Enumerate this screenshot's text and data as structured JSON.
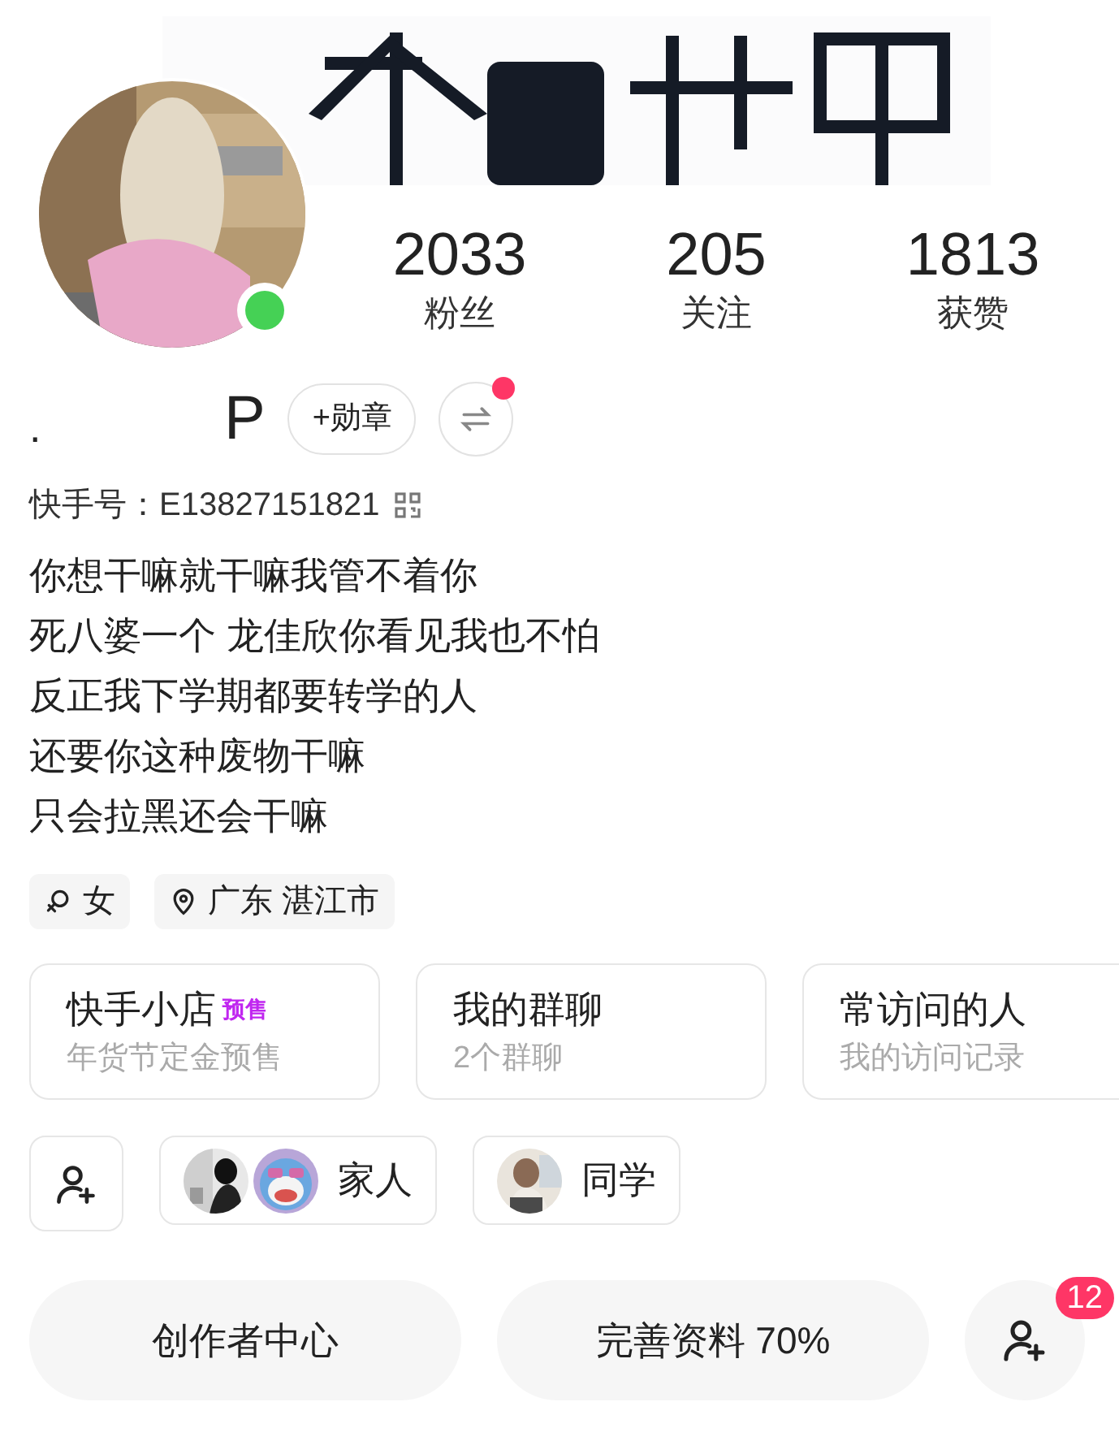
{
  "cover": {
    "kind": "picture"
  },
  "avatar": {
    "kind": "picture",
    "online": true
  },
  "stats": [
    {
      "value": "2033",
      "label": "粉丝"
    },
    {
      "value": "205",
      "label": "关注"
    },
    {
      "value": "1813",
      "label": "获赞"
    }
  ],
  "name_parts": [
    ".",
    "P"
  ],
  "badge_button": "+勋章",
  "switch_button": {
    "has_dot": true
  },
  "account_id": "快手号：E13827151821",
  "bio": [
    "你想干嘛就干嘛我管不着你",
    "死八婆一个 龙佳欣你看见我也不怕",
    "反正我下学期都要转学的人",
    "还要你这种废物干嘛",
    "只会拉黑还会干嘛"
  ],
  "tags": [
    {
      "kind": "gender",
      "text": "女"
    },
    {
      "kind": "location",
      "text": "广东 湛江市"
    }
  ],
  "cards": [
    {
      "title": "快手小店",
      "badge": "预售",
      "subtitle": "年货节定金预售"
    },
    {
      "title": "我的群聊",
      "subtitle": "2个群聊"
    },
    {
      "title": "常访问的人",
      "subtitle": "我的访问记录"
    }
  ],
  "groups": [
    {
      "label": "家人",
      "avatars": [
        {
          "kind": "picture"
        },
        {
          "kind": "picture"
        }
      ]
    },
    {
      "label": "同学",
      "avatars": [
        {
          "kind": "picture"
        }
      ]
    }
  ],
  "actions": [
    {
      "kind": "text",
      "label": "创作者中心"
    },
    {
      "kind": "text",
      "label": "完善资料 70%"
    },
    {
      "kind": "icon",
      "badge": "12"
    }
  ]
}
